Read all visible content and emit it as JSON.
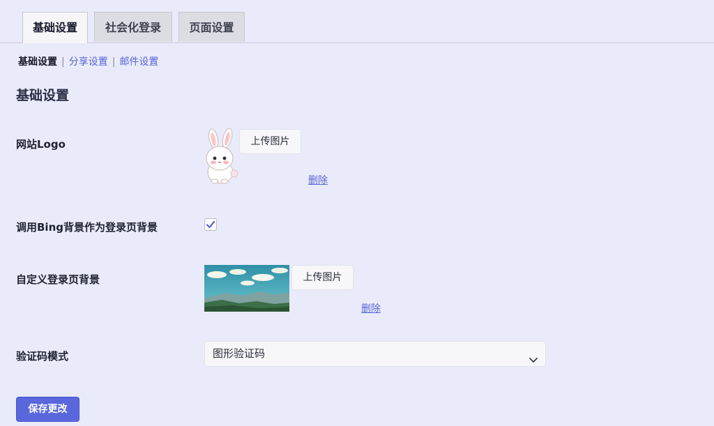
{
  "tabs": [
    {
      "label": "基础设置",
      "active": true
    },
    {
      "label": "社会化登录",
      "active": false
    },
    {
      "label": "页面设置",
      "active": false
    }
  ],
  "subnav": {
    "current": "基础设置",
    "separator": "|",
    "links": [
      "分享设置",
      "邮件设置"
    ]
  },
  "section_title": "基础设置",
  "fields": {
    "logo": {
      "label": "网站Logo",
      "upload": "上传图片",
      "delete": "删除",
      "image": "bunny-logo-image"
    },
    "bing": {
      "label": "调用Bing背景作为登录页背景",
      "checked": true
    },
    "background": {
      "label": "自定义登录页背景",
      "upload": "上传图片",
      "delete": "删除",
      "image": "landscape-thumbnail"
    },
    "captcha": {
      "label": "验证码模式",
      "value": "图形验证码"
    }
  },
  "save_button": "保存更改",
  "colors": {
    "page_bg": "#eaebfa",
    "accent": "#5a67dc",
    "link": "#5a66d6",
    "active_tab_bg": "#f6f6f8",
    "inactive_tab_bg": "#dcdde3"
  }
}
